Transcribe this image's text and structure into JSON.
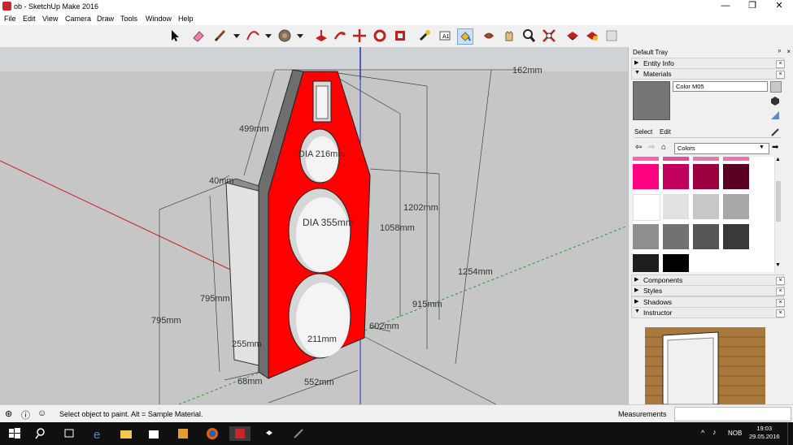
{
  "window": {
    "title": "ob - SketchUp Make 2016",
    "min": "—",
    "max": "❐",
    "close": "✕"
  },
  "menu": [
    "File",
    "Edit",
    "View",
    "Camera",
    "Draw",
    "Tools",
    "Window",
    "Help"
  ],
  "toolbar": {
    "icons": [
      "select-icon",
      "eraser-icon",
      "line-icon",
      "arc-icon",
      "shape-icon",
      "push-pull-icon",
      "move-icon",
      "rotate-icon",
      "scale-icon",
      "offset-icon",
      "tape-measure-icon",
      "text-icon",
      "paint-bucket-icon",
      "orbit-icon",
      "pan-icon",
      "zoom-icon",
      "zoom-extents-icon",
      "warehouse-icon",
      "extension-warehouse-icon",
      "layout-icon"
    ]
  },
  "viewport": {
    "dimensions": [
      "162mm",
      "499mm",
      "40mm",
      "DIA 216mm",
      "1202mm",
      "1058mm",
      "DIA 355mm",
      "1254mm",
      "795mm",
      "795mm",
      "915mm",
      "602mm",
      "211mm",
      "255mm",
      "68mm",
      "552mm"
    ]
  },
  "tray": {
    "title": "Default Tray",
    "pin": "ᵖ",
    "close": "×",
    "entity_info": "Entity Info",
    "materials": "Materials",
    "material_name": "Color M05",
    "tab_select": "Select",
    "tab_edit": "Edit",
    "library": "Colors",
    "components": "Components",
    "styles": "Styles",
    "shadows": "Shadows",
    "instructor": "Instructor",
    "panel_close": "×",
    "swatches": [
      "#ff0080",
      "#c0005a",
      "#99003d",
      "#5a0025",
      "#ffffff",
      "#e2e2e2",
      "#c8c8c8",
      "#a8a8a8",
      "#8e8e8e",
      "#727272",
      "#555555",
      "#393939",
      "#1e1e1e",
      "#000000"
    ]
  },
  "status": {
    "text": "Select object to paint. Alt = Sample Material.",
    "measurements_label": "Measurements",
    "measurements_value": ""
  },
  "taskbar": {
    "lang": "NOB",
    "time": "19:03",
    "date": "29.05.2016"
  }
}
